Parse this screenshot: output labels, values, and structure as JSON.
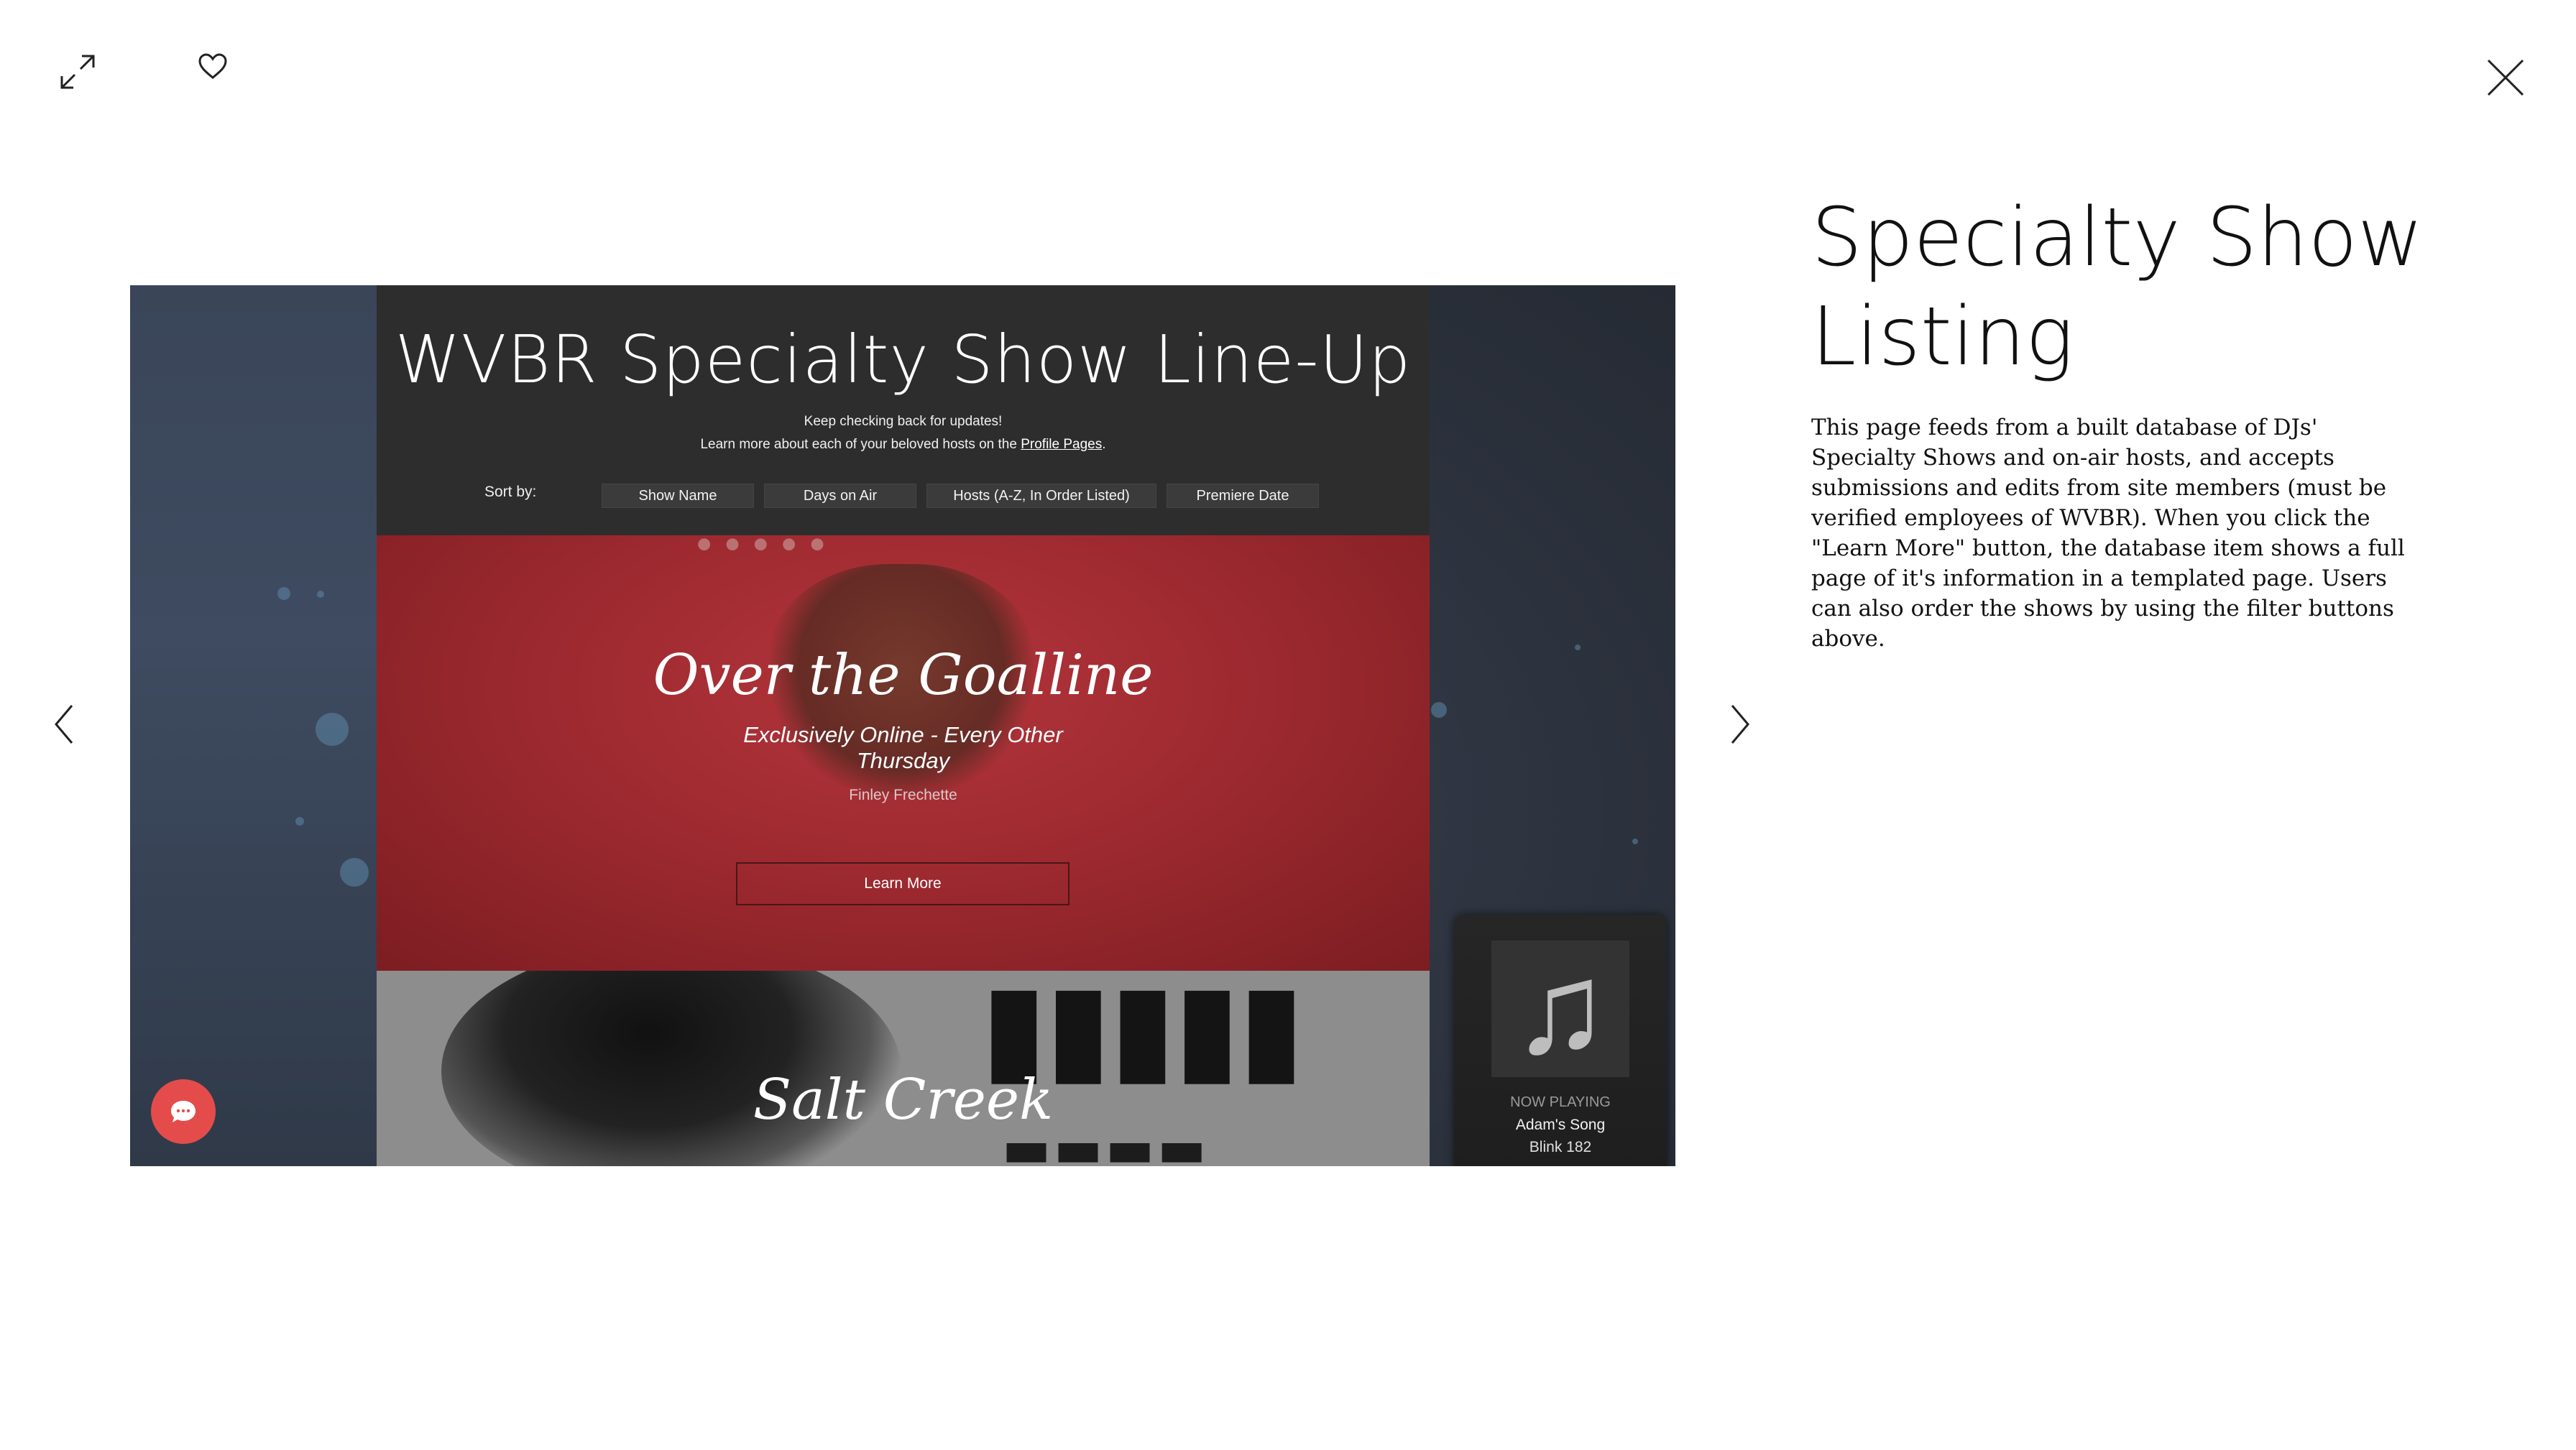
{
  "viewer": {
    "expand_icon": "expand-arrows-icon",
    "heart_icon": "heart-icon",
    "close_icon": "close-x-icon",
    "prev_icon": "chevron-left-icon",
    "next_icon": "chevron-right-icon"
  },
  "site": {
    "title": "WVBR Specialty Show Line-Up",
    "subtitle_line1": "Keep checking back for updates!",
    "subtitle_line2_prefix": "Learn more about each of your beloved hosts on the ",
    "subtitle_link": "Profile Pages",
    "subtitle_line2_suffix": ".",
    "sort_label": "Sort by:",
    "sort_buttons": [
      "Show Name",
      "Days on Air",
      "Hosts (A-Z, In Order Listed)",
      "Premiere Date"
    ],
    "shows": [
      {
        "title": "Over the Goalline",
        "schedule": "Exclusively Online - Every Other Thursday",
        "host": "Finley Frechette",
        "button": "Learn More"
      },
      {
        "title": "Salt Creek"
      }
    ]
  },
  "player": {
    "label": "NOW PLAYING",
    "song": "Adam's Song",
    "artist": "Blink 182",
    "icon": "music-note-icon"
  },
  "chat": {
    "icon": "chat-bubble-icon"
  },
  "panel": {
    "title_line1": "Specialty Show",
    "title_line2": "Listing",
    "description": "This page feeds from a built database of DJs' Specialty Shows and on-air hosts, and accepts submissions and edits from site members (must be verified employees of WVBR). When you click the \"Learn More\" button, the database item shows a full page of it's information in a templated page. Users can also order the shows by using the filter buttons above."
  },
  "colors": {
    "accent_red": "#e44c4c",
    "show_red": "#a12b31",
    "site_dark": "#2d2d2d"
  }
}
